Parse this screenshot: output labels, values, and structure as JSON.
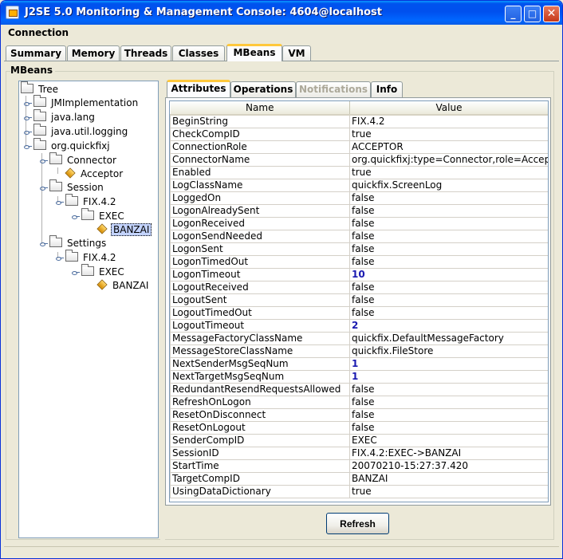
{
  "window": {
    "title": "J2SE 5.0 Monitoring & Management Console: 4604@localhost",
    "controls": {
      "minimize": "_",
      "maximize": "□",
      "close": "✕"
    }
  },
  "menu": {
    "items": [
      {
        "label": "Connection"
      }
    ]
  },
  "tabs": [
    {
      "label": "Summary",
      "active": false
    },
    {
      "label": "Memory",
      "active": false
    },
    {
      "label": "Threads",
      "active": false
    },
    {
      "label": "Classes",
      "active": false
    },
    {
      "label": "MBeans",
      "active": true
    },
    {
      "label": "VM",
      "active": false
    }
  ],
  "mbeans": {
    "section_label": "MBeans",
    "tree": {
      "root": "Tree",
      "nodes": [
        {
          "label": "JMImplementation",
          "icon": "folder-icon",
          "depth": 1
        },
        {
          "label": "java.lang",
          "icon": "folder-icon",
          "depth": 1
        },
        {
          "label": "java.util.logging",
          "icon": "folder-icon",
          "depth": 1
        },
        {
          "label": "org.quickfixj",
          "icon": "folder-icon",
          "depth": 1
        },
        {
          "label": "Connector",
          "icon": "folder-icon",
          "depth": 2
        },
        {
          "label": "Acceptor",
          "icon": "mbean-icon",
          "depth": 3
        },
        {
          "label": "Session",
          "icon": "folder-icon",
          "depth": 2
        },
        {
          "label": "FIX.4.2",
          "icon": "folder-icon",
          "depth": 3
        },
        {
          "label": "EXEC",
          "icon": "folder-icon",
          "depth": 4
        },
        {
          "label": "BANZAI",
          "icon": "mbean-icon",
          "depth": 5,
          "selected": true
        },
        {
          "label": "Settings",
          "icon": "folder-icon",
          "depth": 2
        },
        {
          "label": "FIX.4.2",
          "icon": "folder-icon",
          "depth": 3
        },
        {
          "label": "EXEC",
          "icon": "folder-icon",
          "depth": 4
        },
        {
          "label": "BANZAI",
          "icon": "mbean-icon",
          "depth": 5
        }
      ]
    },
    "subtabs": [
      {
        "label": "Attributes",
        "active": true,
        "enabled": true
      },
      {
        "label": "Operations",
        "active": false,
        "enabled": true
      },
      {
        "label": "Notifications",
        "active": false,
        "enabled": false
      },
      {
        "label": "Info",
        "active": false,
        "enabled": true
      }
    ],
    "attributes": {
      "columns": [
        "Name",
        "Value"
      ],
      "rows": [
        {
          "name": "BeginString",
          "value": "FIX.4.2",
          "numeric": false
        },
        {
          "name": "CheckCompID",
          "value": "true",
          "numeric": false
        },
        {
          "name": "ConnectionRole",
          "value": "ACCEPTOR",
          "numeric": false
        },
        {
          "name": "ConnectorName",
          "value": "org.quickfixj:type=Connector,role=Acceptor",
          "numeric": false
        },
        {
          "name": "Enabled",
          "value": "true",
          "numeric": false
        },
        {
          "name": "LogClassName",
          "value": "quickfix.ScreenLog",
          "numeric": false
        },
        {
          "name": "LoggedOn",
          "value": "false",
          "numeric": false
        },
        {
          "name": "LogonAlreadySent",
          "value": "false",
          "numeric": false
        },
        {
          "name": "LogonReceived",
          "value": "false",
          "numeric": false
        },
        {
          "name": "LogonSendNeeded",
          "value": "false",
          "numeric": false
        },
        {
          "name": "LogonSent",
          "value": "false",
          "numeric": false
        },
        {
          "name": "LogonTimedOut",
          "value": "false",
          "numeric": false
        },
        {
          "name": "LogonTimeout",
          "value": "10",
          "numeric": true
        },
        {
          "name": "LogoutReceived",
          "value": "false",
          "numeric": false
        },
        {
          "name": "LogoutSent",
          "value": "false",
          "numeric": false
        },
        {
          "name": "LogoutTimedOut",
          "value": "false",
          "numeric": false
        },
        {
          "name": "LogoutTimeout",
          "value": "2",
          "numeric": true
        },
        {
          "name": "MessageFactoryClassName",
          "value": "quickfix.DefaultMessageFactory",
          "numeric": false
        },
        {
          "name": "MessageStoreClassName",
          "value": "quickfix.FileStore",
          "numeric": false
        },
        {
          "name": "NextSenderMsgSeqNum",
          "value": "1",
          "numeric": true
        },
        {
          "name": "NextTargetMsgSeqNum",
          "value": "1",
          "numeric": true
        },
        {
          "name": "RedundantResendRequestsAllowed",
          "value": "false",
          "numeric": false
        },
        {
          "name": "RefreshOnLogon",
          "value": "false",
          "numeric": false
        },
        {
          "name": "ResetOnDisconnect",
          "value": "false",
          "numeric": false
        },
        {
          "name": "ResetOnLogout",
          "value": "false",
          "numeric": false
        },
        {
          "name": "SenderCompID",
          "value": "EXEC",
          "numeric": false
        },
        {
          "name": "SessionID",
          "value": "FIX.4.2:EXEC->BANZAI",
          "numeric": false
        },
        {
          "name": "StartTime",
          "value": "20070210-15:27:37.420",
          "numeric": false
        },
        {
          "name": "TargetCompID",
          "value": "BANZAI",
          "numeric": false
        },
        {
          "name": "UsingDataDictionary",
          "value": "true",
          "numeric": false
        }
      ]
    },
    "refresh_label": "Refresh"
  },
  "colors": {
    "titlebar": "#0054e3",
    "numeric_value": "#1a1ab0",
    "active_tab_accent": "#ffc83c",
    "selection": "#c3d3fd"
  }
}
